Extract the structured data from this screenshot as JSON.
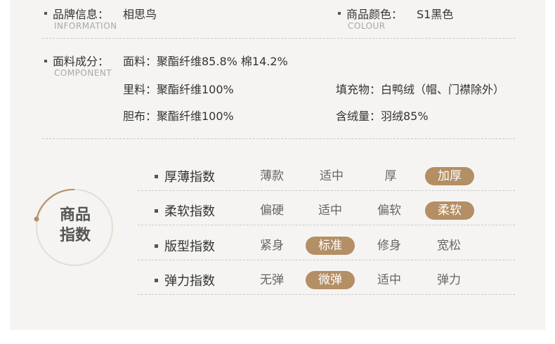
{
  "info": {
    "brand": {
      "label": "品牌信息：",
      "value": "相思鸟",
      "sub": "INFORMATION"
    },
    "color": {
      "label": "商品颜色：",
      "value": "S1黑色",
      "sub": "COLOUR"
    }
  },
  "component": {
    "label": "面料成分：",
    "sub": "COMPONENT",
    "fabric": "面料：聚酯纤维85.8% 棉14.2%",
    "lining": "里料：聚酯纤维100%",
    "filling": "填充物：白鸭绒（帽、门襟除外）",
    "inner": "胆布：聚酯纤维100%",
    "down": "含绒量：羽绒85%"
  },
  "index": {
    "title_line1": "商品",
    "title_line2": "指数",
    "accent_color": "#b48e64",
    "rows": [
      {
        "label": "厚薄指数",
        "options": [
          "薄款",
          "适中",
          "厚",
          "加厚"
        ],
        "selected": "加厚"
      },
      {
        "label": "柔软指数",
        "options": [
          "偏硬",
          "适中",
          "偏软",
          "柔软"
        ],
        "selected": "柔软"
      },
      {
        "label": "版型指数",
        "options": [
          "紧身",
          "标准",
          "修身",
          "宽松"
        ],
        "selected": "标准"
      },
      {
        "label": "弹力指数",
        "options": [
          "无弹",
          "微弹",
          "适中",
          "弹力"
        ],
        "selected": "微弹"
      }
    ]
  }
}
